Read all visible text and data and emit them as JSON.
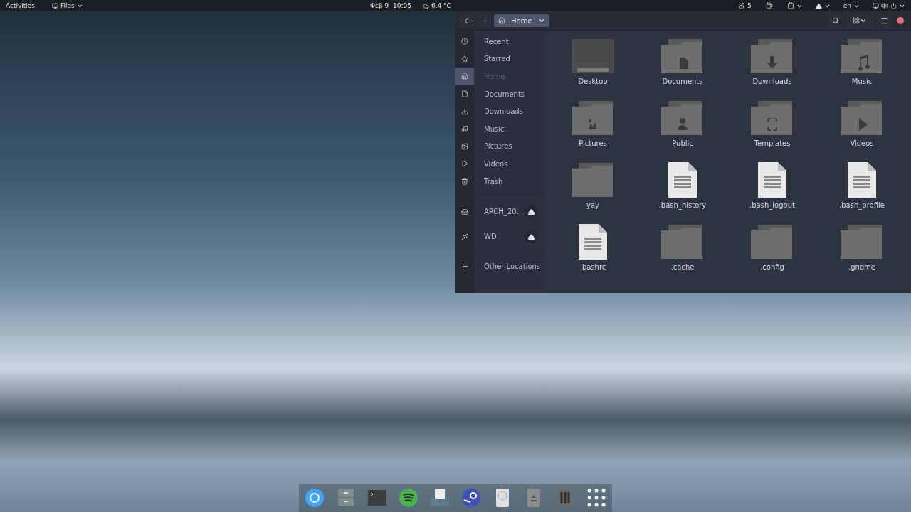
{
  "top_bar": {
    "activities": "Activities",
    "app_menu": "Files",
    "clock": "Φεβ 9  10:05",
    "weather": "6.4 °C",
    "indicator_count": "5",
    "keyboard_layout": "en"
  },
  "file_window": {
    "back": {
      "disabled": false
    },
    "forward": {
      "disabled": true
    },
    "path": {
      "label": "Home"
    },
    "sidebar": {
      "places": [
        {
          "kind": "recent",
          "label": "Recent",
          "selected": false
        },
        {
          "kind": "starred",
          "label": "Starred",
          "selected": false
        },
        {
          "kind": "home",
          "label": "Home",
          "selected": true
        },
        {
          "kind": "documents",
          "label": "Documents",
          "selected": false
        },
        {
          "kind": "downloads",
          "label": "Downloads",
          "selected": false
        },
        {
          "kind": "music",
          "label": "Music",
          "selected": false
        },
        {
          "kind": "pictures",
          "label": "Pictures",
          "selected": false
        },
        {
          "kind": "videos",
          "label": "Videos",
          "selected": false
        },
        {
          "kind": "trash",
          "label": "Trash",
          "selected": false
        }
      ],
      "devices": [
        {
          "kind": "drive",
          "label": "ARCH_20…",
          "selected": false
        },
        {
          "kind": "usb",
          "label": "WD",
          "selected": false
        }
      ],
      "other_locations": {
        "label": "Other Locations"
      }
    },
    "items": [
      {
        "kind": "desktop",
        "name": "Desktop"
      },
      {
        "kind": "documents",
        "name": "Documents"
      },
      {
        "kind": "downloads",
        "name": "Downloads"
      },
      {
        "kind": "music",
        "name": "Music"
      },
      {
        "kind": "pictures",
        "name": "Pictures"
      },
      {
        "kind": "public",
        "name": "Public"
      },
      {
        "kind": "templates",
        "name": "Templates"
      },
      {
        "kind": "videos",
        "name": "Videos"
      },
      {
        "kind": "folder",
        "name": "yay"
      },
      {
        "kind": "file",
        "name": ".bash_history"
      },
      {
        "kind": "file",
        "name": ".bash_logout"
      },
      {
        "kind": "file",
        "name": ".bash_profile"
      },
      {
        "kind": "file",
        "name": ".bashrc"
      },
      {
        "kind": "folder",
        "name": ".cache"
      },
      {
        "kind": "folder",
        "name": ".config"
      },
      {
        "kind": "folder",
        "name": ".gnome"
      }
    ]
  }
}
